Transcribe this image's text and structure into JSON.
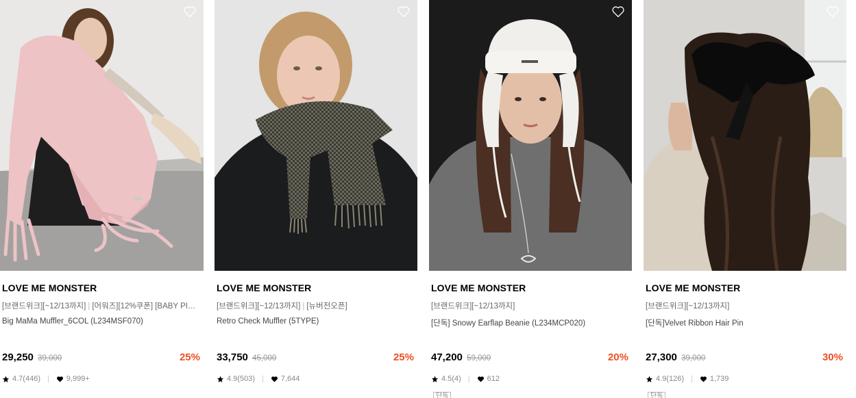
{
  "products": [
    {
      "brand": "LOVE ME MONSTER",
      "promo1": "[브랜드위크][~12/13까지]",
      "promo2": "[어워즈][12%쿠폰] [BABY PINK...",
      "name": "Big MaMa Muffler_6COL (L234MSF070)",
      "price": "29,250",
      "original_price": "39,000",
      "discount": "25%",
      "rating": "4.7",
      "review_count": "(446)",
      "likes": "9,999+",
      "tag": ""
    },
    {
      "brand": "LOVE ME MONSTER",
      "promo1": "[브랜드위크][~12/13까지]",
      "promo2": "[뉴버전오픈]",
      "name": "Retro Check Muffler (5TYPE)",
      "price": "33,750",
      "original_price": "45,000",
      "discount": "25%",
      "rating": "4.9",
      "review_count": "(503)",
      "likes": "7,644",
      "tag": ""
    },
    {
      "brand": "LOVE ME MONSTER",
      "promo1": "[브랜드위크][~12/13까지]",
      "promo2": "",
      "name": "[단독] Snowy Earflap Beanie (L234MCP020)",
      "price": "47,200",
      "original_price": "59,000",
      "discount": "20%",
      "rating": "4.5",
      "review_count": "(4)",
      "likes": "612",
      "tag": "단독"
    },
    {
      "brand": "LOVE ME MONSTER",
      "promo1": "[브랜드위크][~12/13까지]",
      "promo2": "",
      "name": "[단독]Velvet Ribbon Hair Pin",
      "price": "27,300",
      "original_price": "39,000",
      "discount": "30%",
      "rating": "4.9",
      "review_count": "(126)",
      "likes": "1,739",
      "tag": "단독"
    }
  ],
  "icons": {
    "wishlist": "heart-outline-icon",
    "rating": "star-icon",
    "likes": "heart-filled-icon"
  },
  "colors": {
    "discount": "#f04e23",
    "text": "#000000",
    "muted": "#888888"
  }
}
